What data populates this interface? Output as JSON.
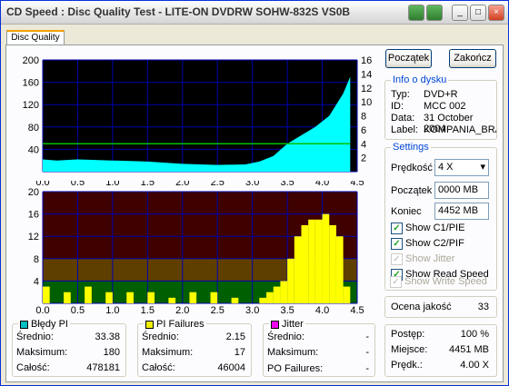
{
  "window": {
    "title": "CD Speed : Disc Quality Test - LITE-ON DVDRW SOHW-832S  VS0B"
  },
  "tab": {
    "label": "Disc Quality"
  },
  "buttons": {
    "start": "Początek",
    "end": "Zakończ"
  },
  "disc_info": {
    "title": "Info o dysku",
    "type_label": "Typ:",
    "type": "DVD+R",
    "id_label": "ID:",
    "id": "MCC 002",
    "date_label": "Data:",
    "date": "31 October 2004",
    "label_label": "Label:",
    "label": "KOMPANIA_BRAC"
  },
  "settings": {
    "title": "Settings",
    "speed_label": "Prędkość",
    "speed": "4 X",
    "start_label": "Początek",
    "start": "0000 MB",
    "end_label": "Koniec",
    "end": "4452 MB",
    "show_c1": "Show C1/PIE",
    "show_c2": "Show C2/PIF",
    "show_jitter": "Show Jitter",
    "show_read": "Show Read Speed",
    "show_write": "Show Write Speed"
  },
  "quality": {
    "label": "Ocena jakość",
    "value": "33"
  },
  "progress": {
    "label": "Postęp:",
    "value": "100 %",
    "pos_label": "Miejsce:",
    "pos": "4451 MB",
    "speed_label": "Prędk.:",
    "speed": "4.00 X"
  },
  "stats": {
    "pi": {
      "title": "Błędy PI",
      "avg_label": "Średnio:",
      "avg": "33.38",
      "max_label": "Maksimum:",
      "max": "180",
      "total_label": "Całość:",
      "total": "478181",
      "color": "#00c0c0"
    },
    "pif": {
      "title": "PI Failures",
      "avg_label": "Średnio:",
      "avg": "2.15",
      "max_label": "Maksimum:",
      "max": "17",
      "total_label": "Całość:",
      "total": "46004",
      "color": "#f0f000"
    },
    "jitter": {
      "title": "Jitter",
      "avg_label": "Średnio:",
      "avg": "-",
      "max_label": "Maksimum:",
      "max": "-",
      "po_label": "PO Failures:",
      "po": "-",
      "color": "#f000f0"
    }
  },
  "chart_data": [
    {
      "type": "area",
      "title": "",
      "x_ticks": [
        "0.0",
        "0.5",
        "1.0",
        "1.5",
        "2.0",
        "2.5",
        "3.0",
        "3.5",
        "4.0",
        "4.5"
      ],
      "xlim": [
        0,
        4.5
      ],
      "y_left_ticks": [
        "200",
        "160",
        "120",
        "80",
        "40"
      ],
      "ylim_left": [
        0,
        200
      ],
      "y_right_ticks": [
        "16",
        "14",
        "12",
        "10",
        "8",
        "6",
        "4",
        "2"
      ],
      "ylim_right": [
        0,
        16
      ],
      "series": [
        {
          "values_x": [
            0,
            0.2,
            0.5,
            1.0,
            1.5,
            2.0,
            2.5,
            2.9,
            3.1,
            3.3,
            3.5,
            3.7,
            3.9,
            4.1,
            4.2,
            4.3,
            4.4
          ],
          "values_y": [
            22,
            20,
            22,
            20,
            18,
            14,
            12,
            13,
            18,
            28,
            50,
            65,
            80,
            100,
            120,
            140,
            170
          ]
        },
        {
          "values_x": [
            0,
            4.4
          ],
          "values_y": [
            4,
            4
          ]
        }
      ]
    },
    {
      "type": "bar",
      "title": "",
      "x_ticks": [
        "0.0",
        "0.5",
        "1.0",
        "1.5",
        "2.0",
        "2.5",
        "3.0",
        "3.5",
        "4.0",
        "4.5"
      ],
      "xlim": [
        0,
        4.5
      ],
      "y_ticks": [
        "20",
        "16",
        "12",
        "8",
        "4"
      ],
      "ylim": [
        0,
        20
      ],
      "series": [
        {
          "values_x": [
            0,
            0.3,
            0.6,
            0.9,
            1.2,
            1.5,
            1.8,
            2.1,
            2.4,
            2.7,
            3.0,
            3.1,
            3.2,
            3.3,
            3.4,
            3.5,
            3.6,
            3.7,
            3.8,
            3.9,
            4.0,
            4.1,
            4.2,
            4.3
          ],
          "values_y": [
            3,
            2,
            3,
            2,
            2,
            2,
            1,
            2,
            2,
            1,
            0,
            1,
            2,
            3,
            4,
            8,
            12,
            14,
            15,
            15,
            16,
            14,
            12,
            3
          ]
        }
      ]
    }
  ]
}
